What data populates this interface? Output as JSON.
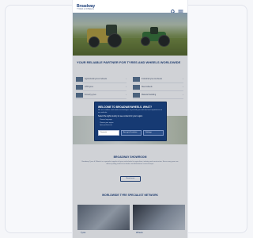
{
  "header": {
    "logo": "Broadway",
    "logo_sub": "TYRES & WHEELS",
    "search_icon": "search-icon",
    "menu_icon": "hamburger-menu-icon"
  },
  "hero": {
    "image": "tractors-in-field-photo"
  },
  "headline": "YOUR RELIABLE PARTNER FOR TYRES AND WHEELS WORLDWIDE",
  "categories": [
    {
      "label": "Agricultural tyres & wheels"
    },
    {
      "label": "Industrial tyres & wheels"
    },
    {
      "label": "OTR tyres"
    },
    {
      "label": "Steel wheels"
    },
    {
      "label": "Forestry tyres"
    },
    {
      "label": "Material handling"
    }
  ],
  "modal": {
    "title": "WELCOME TO BROADWAYWHEELS. WHAT?",
    "text": "We use cookies and similar technologies to provide you with the best experience on our website.",
    "subtitle": "Select the right country to see content for your region",
    "items": [
      "Choose language",
      "Choose your region",
      "Open preferences"
    ],
    "select_value": "Deutsch",
    "btn_primary": "Accept all cookies",
    "btn_secondary": "Settings"
  },
  "about": {
    "title": "BROADWAY SHOWROOM",
    "text": "Broadway Tyres & Wheels is a specialist supplier of tyres and wheels for agriculture, industry and construction. Since many years we deliver quality products to dealers and distributors across Europe.",
    "button": "Read more"
  },
  "specialists": {
    "title": "WORLDWIDE TYRE SPECIALIST NETWORK",
    "tiles": [
      {
        "label": "Tyres"
      },
      {
        "label": "Wheels"
      }
    ]
  },
  "colors": {
    "brand": "#1d3f7a",
    "modal_bg": "#163a73"
  }
}
